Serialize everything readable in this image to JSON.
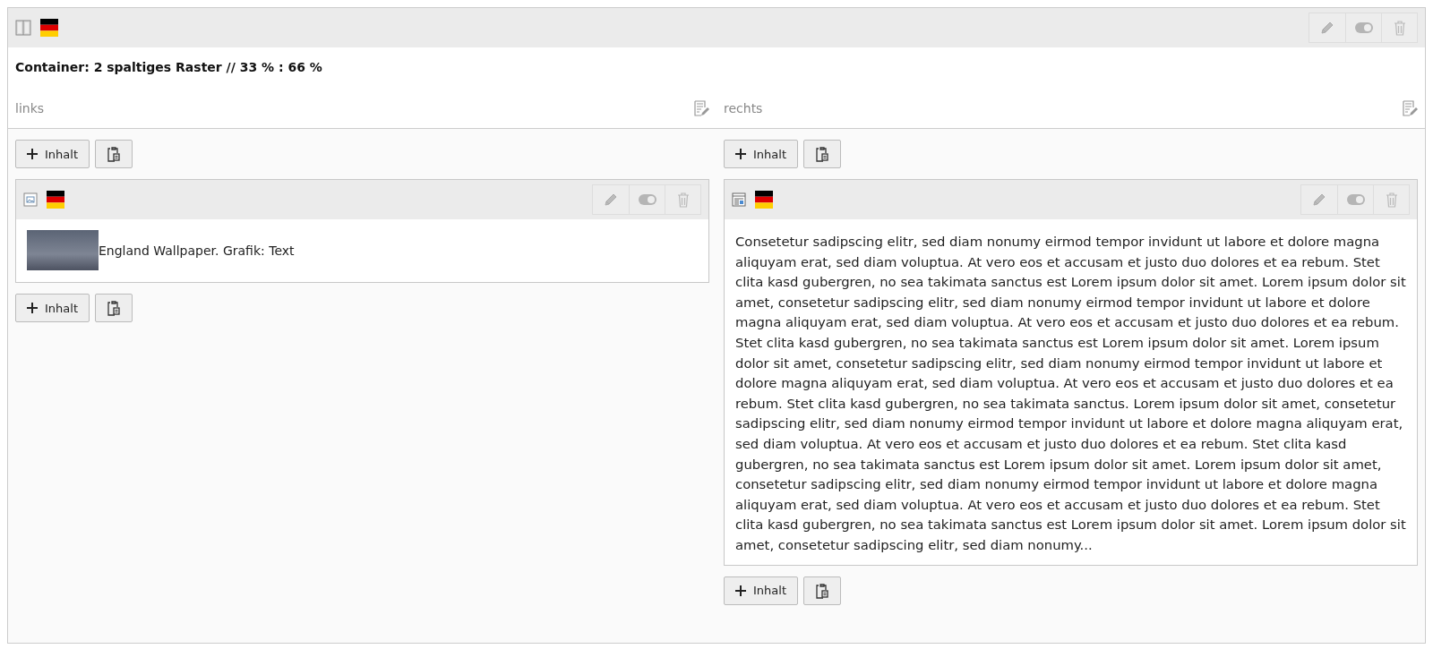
{
  "container": {
    "title": "Container: 2 spaltiges Raster // 33 % : 66 %",
    "columns": [
      {
        "label": "links",
        "add_top": "Inhalt",
        "add_bottom": "Inhalt",
        "elements": [
          {
            "kind": "image",
            "text": "England Wallpaper. Grafik: Text"
          }
        ]
      },
      {
        "label": "rechts",
        "add_top": "Inhalt",
        "add_bottom": "Inhalt",
        "elements": [
          {
            "kind": "text",
            "text": "Consetetur sadipscing elitr, sed diam nonumy eirmod tempor invidunt ut labore et dolore magna aliquyam erat, sed diam voluptua. At vero eos et accusam et justo duo dolores et ea rebum. Stet clita kasd gubergren, no sea takimata sanctus est Lorem ipsum dolor sit amet. Lorem ipsum dolor sit amet, consetetur sadipscing elitr, sed diam nonumy eirmod tempor invidunt ut labore et dolore magna aliquyam erat, sed diam voluptua. At vero eos et accusam et justo duo dolores et ea rebum. Stet clita kasd gubergren, no sea takimata sanctus est Lorem ipsum dolor sit amet. Lorem ipsum dolor sit amet, consetetur sadipscing elitr, sed diam nonumy eirmod tempor invidunt ut labore et dolore magna aliquyam erat, sed diam voluptua. At vero eos et accusam et justo duo dolores et ea rebum. Stet clita kasd gubergren, no sea takimata sanctus. Lorem ipsum dolor sit amet, consetetur sadipscing elitr, sed diam nonumy eirmod tempor invidunt ut labore et dolore magna aliquyam erat, sed diam voluptua. At vero eos et accusam et justo duo dolores et ea rebum. Stet clita kasd gubergren, no sea takimata sanctus est Lorem ipsum dolor sit amet. Lorem ipsum dolor sit amet, consetetur sadipscing elitr, sed diam nonumy eirmod tempor invidunt ut labore et dolore magna aliquyam erat, sed diam voluptua. At vero eos et accusam et justo duo dolores et ea rebum. Stet clita kasd gubergren, no sea takimata sanctus est Lorem ipsum dolor sit amet. Lorem ipsum dolor sit amet, consetetur sadipscing elitr, sed diam nonumy..."
          }
        ]
      }
    ]
  }
}
